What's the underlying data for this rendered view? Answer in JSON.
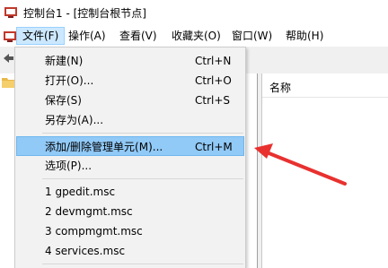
{
  "window": {
    "title": "控制台1 - [控制台根节点]"
  },
  "menubar": {
    "items": [
      {
        "label": "文件(F)"
      },
      {
        "label": "操作(A)"
      },
      {
        "label": "查看(V)"
      },
      {
        "label": "收藏夹(O)"
      },
      {
        "label": "窗口(W)"
      },
      {
        "label": "帮助(H)"
      }
    ]
  },
  "file_menu": {
    "items": [
      {
        "label": "新建(N)",
        "shortcut": "Ctrl+N"
      },
      {
        "label": "打开(O)...",
        "shortcut": "Ctrl+O"
      },
      {
        "label": "保存(S)",
        "shortcut": "Ctrl+S"
      },
      {
        "label": "另存为(A)...",
        "shortcut": ""
      },
      {
        "label": "添加/删除管理单元(M)...",
        "shortcut": "Ctrl+M"
      },
      {
        "label": "选项(P)...",
        "shortcut": ""
      },
      {
        "label": "1 gpedit.msc",
        "shortcut": ""
      },
      {
        "label": "2 devmgmt.msc",
        "shortcut": ""
      },
      {
        "label": "3 compmgmt.msc",
        "shortcut": ""
      },
      {
        "label": "4 services.msc",
        "shortcut": ""
      }
    ]
  },
  "results_pane": {
    "column_name": "名称"
  },
  "colors": {
    "highlight": "#91c9f7",
    "annotation_arrow": "#e8312f",
    "menu_background": "#f2f2f2"
  }
}
